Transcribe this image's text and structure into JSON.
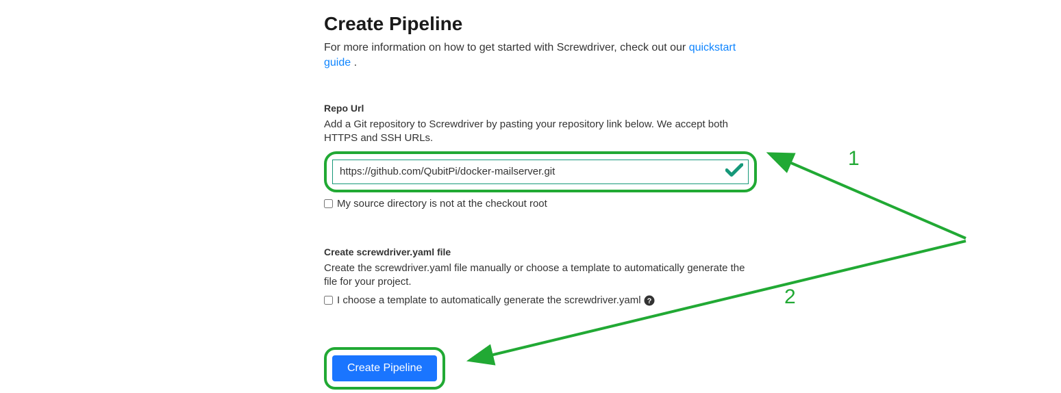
{
  "title": "Create Pipeline",
  "intro": {
    "prefix": "For more information on how to get started with Screwdriver, check out our ",
    "link_text": "quickstart guide",
    "suffix": " ."
  },
  "repo": {
    "label": "Repo Url",
    "description": "Add a Git repository to Screwdriver by pasting your repository link below. We accept both HTTPS and SSH URLs.",
    "value": "https://github.com/QubitPi/docker-mailserver.git",
    "checkbox_label": "My source directory is not at the checkout root"
  },
  "yaml": {
    "label": "Create screwdriver.yaml file",
    "description": "Create the screwdriver.yaml file manually or choose a template to automatically generate the file for your project.",
    "checkbox_label": "I choose a template to automatically generate the screwdriver.yaml"
  },
  "button": {
    "create": "Create Pipeline"
  },
  "annotations": {
    "num1": "1",
    "num2": "2"
  }
}
